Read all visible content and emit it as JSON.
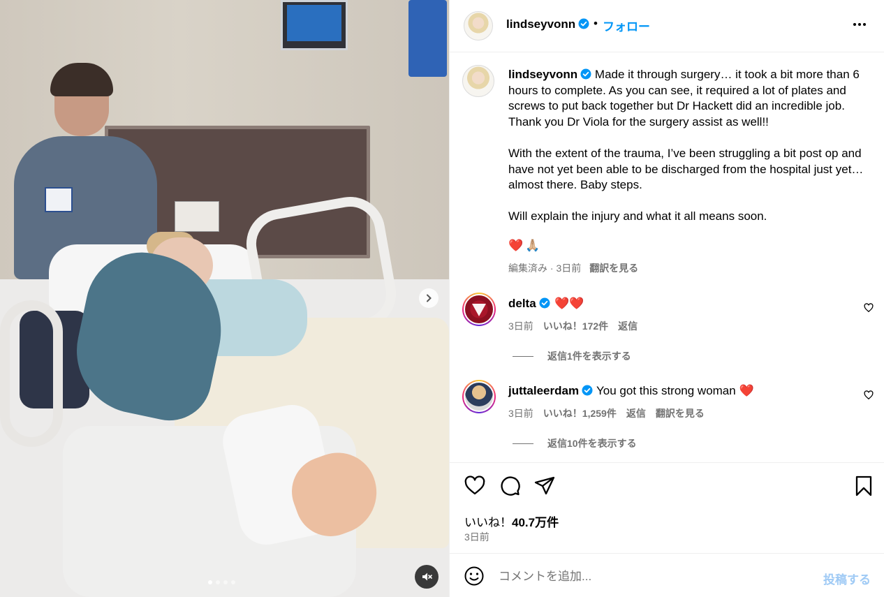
{
  "post": {
    "username": "lindseyvonn",
    "separator": "•",
    "follow_label": "フォロー",
    "caption": "Made it through surgery… it took a bit more than 6 hours to complete. As you can see, it required a lot of plates and screws to put back together but Dr Hackett did an incredible job. Thank you Dr Viola for the surgery assist as well!!\n\nWith the extent of the trauma, I’ve been struggling a bit post op and have not yet been able to be discharged from the hospital just yet… almost there. Baby steps.\n\nWill explain the injury and what it all means soon.",
    "caption_emojis": [
      "❤️",
      "🙏🏼"
    ],
    "edited": "編集済み · 3日前",
    "see_translation": "翻訳を見る",
    "likes_prefix": "いいね！",
    "likes_count": "40.7万件",
    "date": "3日前"
  },
  "media": {
    "carousel_count": 4,
    "carousel_active": 1
  },
  "comments": [
    {
      "username": "delta",
      "text": "❤️❤️",
      "time": "3日前",
      "likes": "いいね！172件",
      "reply": "返信",
      "view_replies": "返信1件を表示する"
    },
    {
      "username": "juttaleerdam",
      "text": "You got this strong woman ❤️",
      "time": "3日前",
      "likes": "いいね！1,259件",
      "reply": "返信",
      "see_translation": "翻訳を見る",
      "view_replies": "返信10件を表示する"
    }
  ],
  "composer": {
    "placeholder": "コメントを追加...",
    "post_label": "投稿する"
  },
  "colors": {
    "accent": "#0095f6",
    "post_disabled": "#9fcaf5",
    "verified": "#0095f6",
    "heart": "#e0162b",
    "secondary_text": "#737373"
  },
  "icons": [
    "verified-badge-icon",
    "more-options-icon",
    "next-arrow-icon",
    "mute-icon",
    "heart-icon",
    "comment-icon",
    "share-icon",
    "save-icon",
    "emoji-icon"
  ]
}
